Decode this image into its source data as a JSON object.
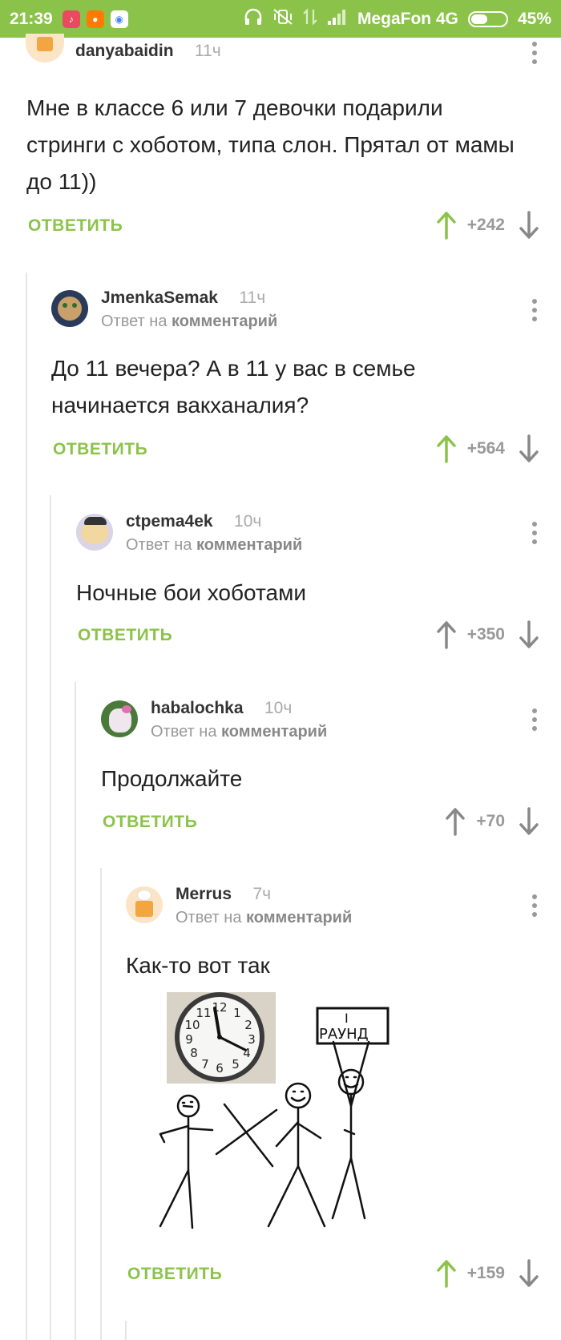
{
  "status_bar": {
    "time": "21:39",
    "carrier": "MegaFon 4G",
    "battery": "45%",
    "app_icons": [
      "tiktok-icon",
      "shop-icon",
      "chrome-icon"
    ]
  },
  "colors": {
    "accent": "#8bc34a",
    "muted": "#999999",
    "thread": "#e6e6e6"
  },
  "comments": [
    {
      "author": "danyabaidin",
      "time": "11ч",
      "reply_prefix": "",
      "reply_target": "",
      "text": "Мне в классе 6 или 7 девочки подарили стринги с хоботом, типа слон. Прятал от мамы до 11))",
      "reply_label": "ОТВЕТИТЬ",
      "score": "+242",
      "upvoted": true
    },
    {
      "author": "JmenkaSemak",
      "time": "11ч",
      "reply_prefix": "Ответ на",
      "reply_target": "комментарий",
      "text": "До 11 вечера? А в 11 у вас в семье начинается вакханалия?",
      "reply_label": "ОТВЕТИТЬ",
      "score": "+564",
      "upvoted": true
    },
    {
      "author": "ctpema4ek",
      "time": "10ч",
      "reply_prefix": "Ответ на",
      "reply_target": "комментарий",
      "text": "Ночные бои хоботами",
      "reply_label": "ОТВЕТИТЬ",
      "score": "+350",
      "upvoted": false
    },
    {
      "author": "habalochka",
      "time": "10ч",
      "reply_prefix": "Ответ на",
      "reply_target": "комментарий",
      "text": "Продолжайте",
      "reply_label": "ОТВЕТИТЬ",
      "score": "+70",
      "upvoted": false
    },
    {
      "author": "Merrus",
      "time": "7ч",
      "reply_prefix": "Ответ на",
      "reply_target": "комментарий",
      "text": "Как-то вот так",
      "reply_label": "ОТВЕТИТЬ",
      "score": "+159",
      "upvoted": true,
      "image": {
        "sign_line1": "I",
        "sign_line2": "РАУНД",
        "clock_numbers": [
          "12",
          "1",
          "2",
          "3",
          "4",
          "5",
          "6",
          "7",
          "8",
          "9",
          "10",
          "11"
        ]
      }
    }
  ]
}
